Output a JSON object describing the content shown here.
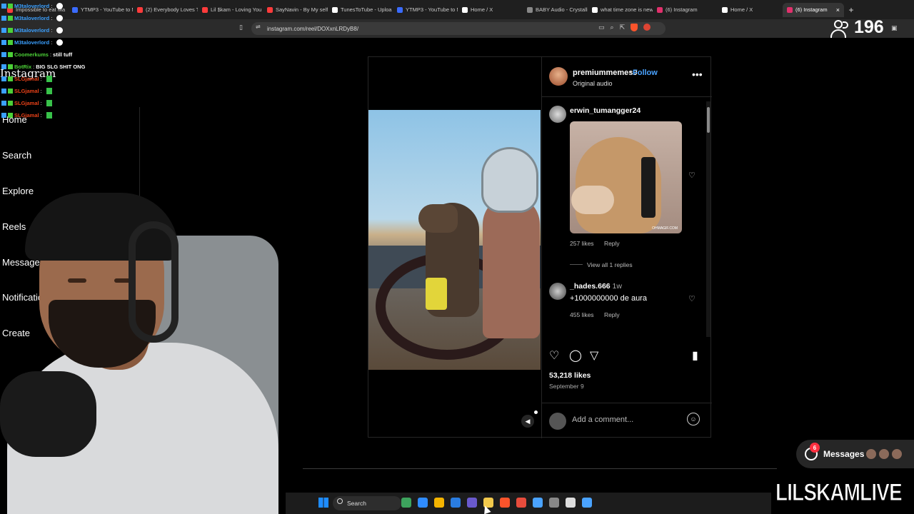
{
  "browser": {
    "tabs": [
      {
        "label": "Impossible to eat Ma",
        "color": "#ff3b3b"
      },
      {
        "label": "YTMP3 - YouTube to M",
        "color": "#3a6bff"
      },
      {
        "label": "(2) Everybody Loves T",
        "color": "#ff3b3b"
      },
      {
        "label": "Lil $kam - Loving You",
        "color": "#ff3b3b"
      },
      {
        "label": "SayNavin - By My self",
        "color": "#ff3b3b"
      },
      {
        "label": "TunesToTube - Uploa",
        "color": "#ffffff"
      },
      {
        "label": "YTMP3 - YouTube to M",
        "color": "#3a6bff"
      },
      {
        "label": "Home / X",
        "color": "#ffffff"
      },
      {
        "label": "BABY Audio - Crystalli",
        "color": "#888888"
      },
      {
        "label": "what time zone is new",
        "color": "#ffffff"
      },
      {
        "label": "(6) Instagram",
        "color": "#e1306c"
      },
      {
        "label": "Home / X",
        "color": "#ffffff"
      },
      {
        "label": "(6) Instagram",
        "color": "#e1306c",
        "active": true
      }
    ],
    "new_tab_label": "+",
    "close_tab_label": "×",
    "url": "instagram.com/reel/DOXxnLRDyB8/"
  },
  "stream": {
    "viewer_count": "196",
    "watermark": "LILSKAMLIVE"
  },
  "chat": [
    {
      "user": "M3taloverlord",
      "msg": "",
      "user_color": "#3ba0ff"
    },
    {
      "user": "M3taloverlord",
      "msg": "",
      "user_color": "#3ba0ff"
    },
    {
      "user": "M3taloverlord",
      "msg": "",
      "user_color": "#3ba0ff"
    },
    {
      "user": "M3taloverlord",
      "msg": "",
      "user_color": "#3ba0ff"
    },
    {
      "user": "Coomerkums",
      "msg": "still tuff",
      "user_color": "#4cd137"
    },
    {
      "user": "BotRix",
      "msg": "BIG SLG SHIT ONG",
      "user_color": "#4cd137"
    },
    {
      "user": "SLGjamal",
      "msg": "",
      "user_color": "#e84118"
    },
    {
      "user": "SLGjamal",
      "msg": "",
      "user_color": "#e84118"
    },
    {
      "user": "SLGjamal",
      "msg": "",
      "user_color": "#e84118"
    },
    {
      "user": "SLGjamal",
      "msg": "",
      "user_color": "#e84118"
    }
  ],
  "instagram": {
    "logo": "Instagram",
    "nav": [
      "Home",
      "Search",
      "Explore",
      "Reels",
      "Messages",
      "Notifications",
      "Create"
    ],
    "post": {
      "author": "premiummemes0",
      "follow_label": "Follow",
      "audio": "Original audio",
      "likes": "53,218 likes",
      "date": "September 9",
      "comment_placeholder": "Add a comment...",
      "comments": [
        {
          "user": "erwin_tumangger24",
          "time": "",
          "text": "",
          "gif_tag": "OHMAGIF.COM",
          "likes": "257 likes",
          "reply": "Reply",
          "view_replies": "View all 1 replies"
        },
        {
          "user": "_hades.666",
          "time": "1w",
          "text": "+1000000000 de aura",
          "likes": "455 likes",
          "reply": "Reply"
        }
      ]
    },
    "messages_label": "Messages",
    "messages_badge": "6"
  },
  "taskbar": {
    "search_label": "Search",
    "icons": [
      "#3da35d",
      "#2f8cff",
      "#f4b400",
      "#2a7de1",
      "#6a5acd",
      "#f2c94c",
      "#fb542b",
      "#e74c3c",
      "#4aa3ff",
      "#888888",
      "#dddddd",
      "#4aa3ff"
    ]
  }
}
